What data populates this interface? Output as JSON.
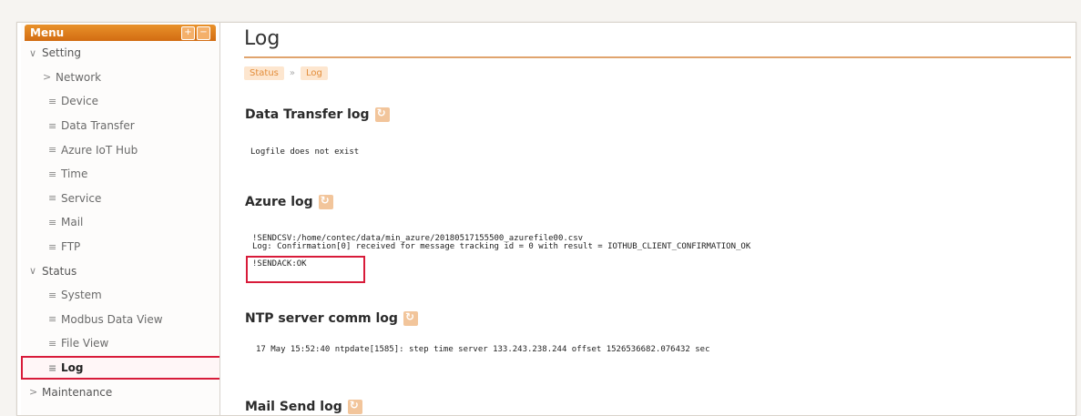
{
  "sidebar": {
    "title": "Menu",
    "ctrl_expand": "+",
    "ctrl_collapse": "−",
    "items": [
      {
        "label": "Setting",
        "mark": "∨"
      },
      {
        "label": "Network",
        "mark": ">"
      },
      {
        "label": "Device",
        "mark": "≡"
      },
      {
        "label": "Data Transfer",
        "mark": "≡"
      },
      {
        "label": "Azure IoT Hub",
        "mark": "≡"
      },
      {
        "label": "Time",
        "mark": "≡"
      },
      {
        "label": "Service",
        "mark": "≡"
      },
      {
        "label": "Mail",
        "mark": "≡"
      },
      {
        "label": "FTP",
        "mark": "≡"
      },
      {
        "label": "Status",
        "mark": "∨"
      },
      {
        "label": "System",
        "mark": "≡"
      },
      {
        "label": "Modbus Data View",
        "mark": "≡"
      },
      {
        "label": "File View",
        "mark": "≡"
      },
      {
        "label": "Log",
        "mark": "≡"
      },
      {
        "label": "Maintenance",
        "mark": ">"
      }
    ]
  },
  "main": {
    "title": "Log",
    "breadcrumb": [
      "Status",
      "Log"
    ],
    "breadcrumb_sep": "»",
    "sections": {
      "data_transfer": {
        "title": "Data Transfer log",
        "text": "Logfile does not exist"
      },
      "azure": {
        "title": "Azure log",
        "lines": [
          "!SENDCSV:/home/contec/data/min_azure/20180517155500_azurefile00.csv",
          "Log: Confirmation[0] received for message tracking id = 0 with result = IOTHUB_CLIENT_CONFIRMATION_OK",
          "!SENDACK:OK"
        ]
      },
      "ntp": {
        "title": "NTP server comm log",
        "text": "17 May 15:52:40 ntpdate[1585]: step time server 133.243.238.244 offset 1526536682.076432 sec"
      },
      "mail": {
        "title": "Mail Send log"
      }
    }
  },
  "colors": {
    "accent": "#d26c12",
    "highlight": "#d81b3a"
  },
  "icons": {
    "refresh": "refresh-icon"
  }
}
